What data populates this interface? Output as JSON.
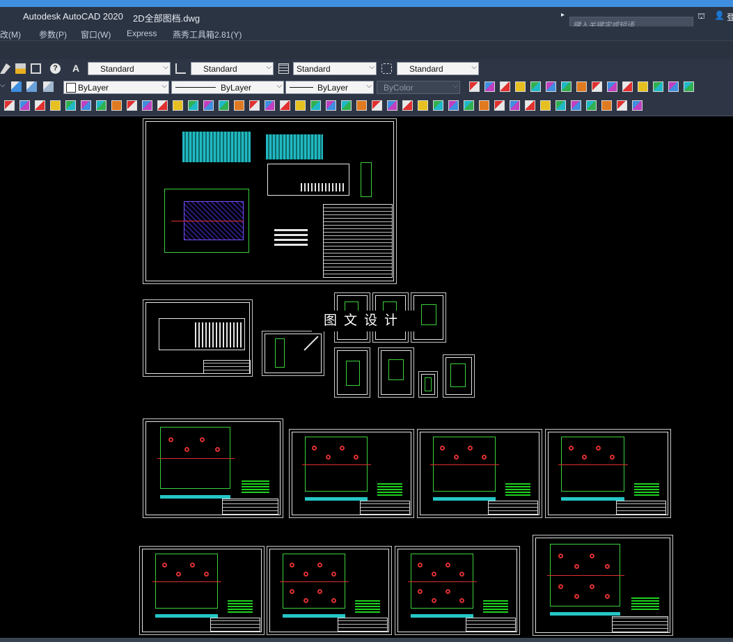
{
  "app": {
    "title": "Autodesk AutoCAD 2020",
    "document": "2D全部图档.dwg",
    "search_placeholder": "键入关键字或短语"
  },
  "menu": {
    "items": [
      "改(M)",
      "参数(P)",
      "窗口(W)",
      "Express",
      "燕秀工具箱2.81(Y)"
    ]
  },
  "styles": {
    "text_style": "Standard",
    "dim_style": "Standard",
    "table_style": "Standard",
    "mleader_style": "Standard"
  },
  "properties": {
    "color": "ByLayer",
    "linetype": "ByLayer",
    "lineweight": "ByLayer",
    "plotstyle": "ByColor"
  },
  "watermark": "图文设计",
  "colors": {
    "accent": "#3f8ee0",
    "toolbar_bg": "#2e3646",
    "canvas_bg": "#000000",
    "drawing_green": "#3cd23c",
    "drawing_cyan": "#25c6c6",
    "drawing_red": "#e03030",
    "drawing_magenta": "#e0287a"
  }
}
